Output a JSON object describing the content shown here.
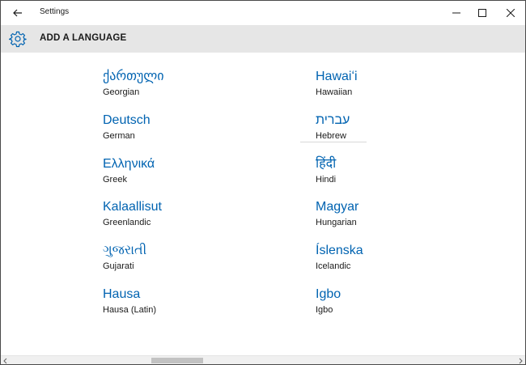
{
  "window": {
    "title": "Settings"
  },
  "header": {
    "title": "ADD A LANGUAGE",
    "icon": "gear-icon"
  },
  "languages": [
    {
      "native": "ქართული",
      "english": "Georgian"
    },
    {
      "native": "Deutsch",
      "english": "German"
    },
    {
      "native": "Ελληνικά",
      "english": "Greek"
    },
    {
      "native": "Kalaallisut",
      "english": "Greenlandic"
    },
    {
      "native": "ગુજરાતી",
      "english": "Gujarati"
    },
    {
      "native": "Hausa",
      "english": "Hausa (Latin)"
    },
    {
      "native": "Hawaiʻi",
      "english": "Hawaiian"
    },
    {
      "native": "עברית",
      "english": "Hebrew"
    },
    {
      "native": "हिंदी",
      "english": "Hindi"
    },
    {
      "native": "Magyar",
      "english": "Hungarian"
    },
    {
      "native": "Íslenska",
      "english": "Icelandic"
    },
    {
      "native": "Igbo",
      "english": "Igbo"
    }
  ],
  "colors": {
    "accent": "#0063b1",
    "header_bg": "#e6e6e6",
    "text": "#1a1a1a"
  }
}
